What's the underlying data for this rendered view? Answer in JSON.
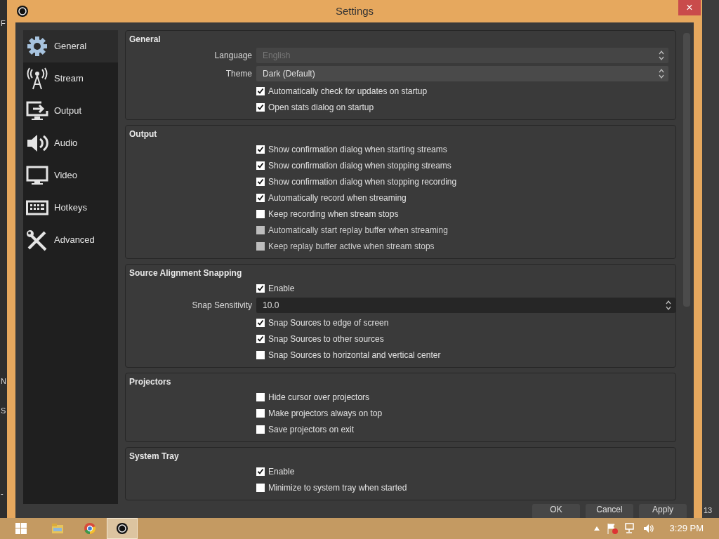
{
  "background_app": {
    "left_texts": [
      "F",
      "N",
      "S",
      "-"
    ],
    "right_texts": [
      "13"
    ]
  },
  "window": {
    "title": "Settings",
    "close": "×"
  },
  "sidebar": {
    "items": [
      {
        "label": "General",
        "kind": "gear",
        "selected": true
      },
      {
        "label": "Stream",
        "kind": "antenna",
        "selected": false
      },
      {
        "label": "Output",
        "kind": "output",
        "selected": false
      },
      {
        "label": "Audio",
        "kind": "speaker",
        "selected": false
      },
      {
        "label": "Video",
        "kind": "monitor",
        "selected": false
      },
      {
        "label": "Hotkeys",
        "kind": "keyboard",
        "selected": false
      },
      {
        "label": "Advanced",
        "kind": "tools",
        "selected": false
      }
    ]
  },
  "sections": [
    {
      "title": "General",
      "rows": [
        {
          "kind": "select",
          "label": "Language",
          "value": "English",
          "disabled": true
        },
        {
          "kind": "select",
          "label": "Theme",
          "value": "Dark (Default)",
          "disabled": false
        },
        {
          "kind": "checkbox",
          "label": "Automatically check for updates on startup",
          "checked": true,
          "disabled": false
        },
        {
          "kind": "checkbox",
          "label": "Open stats dialog on startup",
          "checked": true,
          "disabled": false
        }
      ]
    },
    {
      "title": "Output",
      "rows": [
        {
          "kind": "checkbox",
          "label": "Show confirmation dialog when starting streams",
          "checked": true,
          "disabled": false
        },
        {
          "kind": "checkbox",
          "label": "Show confirmation dialog when stopping streams",
          "checked": true,
          "disabled": false
        },
        {
          "kind": "checkbox",
          "label": "Show confirmation dialog when stopping recording",
          "checked": true,
          "disabled": false
        },
        {
          "kind": "checkbox",
          "label": "Automatically record when streaming",
          "checked": true,
          "disabled": false
        },
        {
          "kind": "checkbox",
          "label": "Keep recording when stream stops",
          "checked": false,
          "disabled": false
        },
        {
          "kind": "checkbox",
          "label": "Automatically start replay buffer when streaming",
          "checked": false,
          "disabled": true
        },
        {
          "kind": "checkbox",
          "label": "Keep replay buffer active when stream stops",
          "checked": false,
          "disabled": true
        }
      ]
    },
    {
      "title": "Source Alignment Snapping",
      "rows": [
        {
          "kind": "checkbox",
          "label": "Enable",
          "checked": true,
          "disabled": false
        },
        {
          "kind": "spin",
          "label": "Snap Sensitivity",
          "value": "10.0"
        },
        {
          "kind": "checkbox",
          "label": "Snap Sources to edge of screen",
          "checked": true,
          "disabled": false
        },
        {
          "kind": "checkbox",
          "label": "Snap Sources to other sources",
          "checked": true,
          "disabled": false
        },
        {
          "kind": "checkbox",
          "label": "Snap Sources to horizontal and vertical center",
          "checked": false,
          "disabled": false
        }
      ]
    },
    {
      "title": "Projectors",
      "rows": [
        {
          "kind": "checkbox",
          "label": "Hide cursor over projectors",
          "checked": false,
          "disabled": false
        },
        {
          "kind": "checkbox",
          "label": "Make projectors always on top",
          "checked": false,
          "disabled": false
        },
        {
          "kind": "checkbox",
          "label": "Save projectors on exit",
          "checked": false,
          "disabled": false
        }
      ]
    },
    {
      "title": "System Tray",
      "rows": [
        {
          "kind": "checkbox",
          "label": "Enable",
          "checked": true,
          "disabled": false
        },
        {
          "kind": "checkbox",
          "label": "Minimize to system tray when started",
          "checked": false,
          "disabled": false
        }
      ]
    }
  ],
  "buttons": [
    "OK",
    "Cancel",
    "Apply"
  ],
  "taskbar": {
    "apps": [
      {
        "kind": "folder",
        "selected": false
      },
      {
        "kind": "browser",
        "selected": false
      },
      {
        "kind": "obs",
        "selected": true
      }
    ],
    "clock": "3:29 PM"
  }
}
